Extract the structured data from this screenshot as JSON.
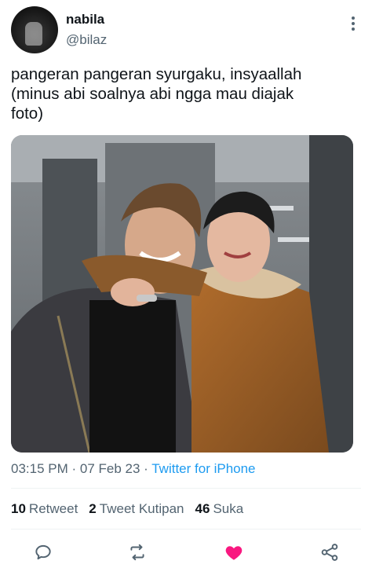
{
  "tweet": {
    "author": {
      "display_name": "nabila",
      "handle": "@bilaz"
    },
    "text": "pangeran pangeran syurgaku, insyaallah\n(minus abi soalnya abi ngga mau diajak\nfoto)",
    "timestamp": "03:15 PM · 07 Feb 23 · ",
    "source": "Twitter for iPhone",
    "stats": {
      "retweets": {
        "count": "10",
        "label": "Retweet"
      },
      "quotes": {
        "count": "2",
        "label": "Tweet Kutipan"
      },
      "likes": {
        "count": "46",
        "label": "Suka"
      }
    },
    "liked": true
  },
  "colors": {
    "accent": "#1d9bf0",
    "like": "#f91880",
    "secondary_text": "#536471"
  },
  "icons": {
    "more": "more-vertical-icon",
    "reply": "reply-icon",
    "retweet": "retweet-icon",
    "like": "heart-filled-icon",
    "share": "share-icon"
  }
}
